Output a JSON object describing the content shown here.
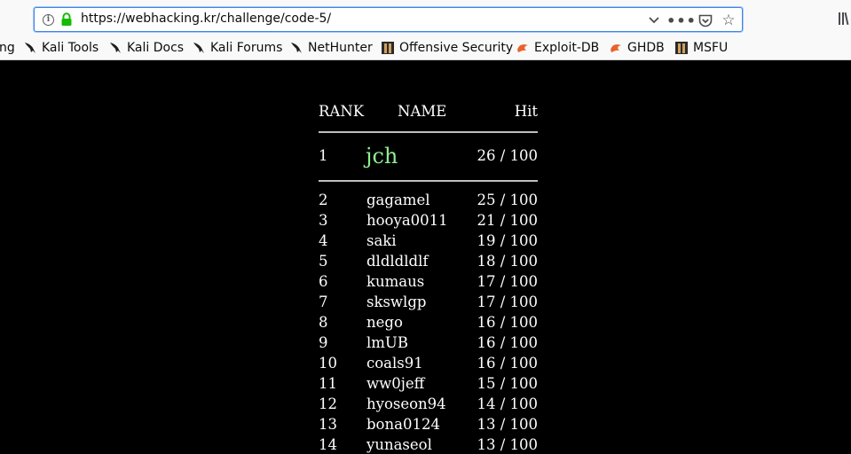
{
  "browser": {
    "url": "https://webhacking.kr/challenge/code-5/",
    "bookmarks": [
      {
        "label": "ng",
        "icon": "none"
      },
      {
        "label": "Kali Tools",
        "icon": "kali-dragon-icon"
      },
      {
        "label": "Kali Docs",
        "icon": "kali-dragon-icon"
      },
      {
        "label": "Kali Forums",
        "icon": "kali-dragon-icon"
      },
      {
        "label": "NetHunter",
        "icon": "kali-dragon-icon"
      },
      {
        "label": "Offensive Security",
        "icon": "offsec-icon"
      },
      {
        "label": "Exploit-DB",
        "icon": "exploitdb-icon"
      },
      {
        "label": "GHDB",
        "icon": "exploitdb-icon"
      },
      {
        "label": "MSFU",
        "icon": "offsec-icon"
      }
    ]
  },
  "table": {
    "headers": {
      "rank": "RANK",
      "name": "NAME",
      "hit": "Hit"
    },
    "first": {
      "rank": "1",
      "name": "jch",
      "hit": "26 / 100"
    },
    "rows": [
      {
        "rank": "2",
        "name": "gagamel",
        "hit": "25 / 100"
      },
      {
        "rank": "3",
        "name": "hooya0011",
        "hit": "21 / 100"
      },
      {
        "rank": "4",
        "name": "saki",
        "hit": "19 / 100"
      },
      {
        "rank": "5",
        "name": "dldldldlf",
        "hit": "18 / 100"
      },
      {
        "rank": "6",
        "name": "kumaus",
        "hit": "17 / 100"
      },
      {
        "rank": "7",
        "name": "skswlgp",
        "hit": "17 / 100"
      },
      {
        "rank": "8",
        "name": "nego",
        "hit": "16 / 100"
      },
      {
        "rank": "9",
        "name": "lmUB",
        "hit": "16 / 100"
      },
      {
        "rank": "10",
        "name": "coals91",
        "hit": "16 / 100"
      },
      {
        "rank": "11",
        "name": "ww0jeff",
        "hit": "15 / 100"
      },
      {
        "rank": "12",
        "name": "hyoseon94",
        "hit": "14 / 100"
      },
      {
        "rank": "13",
        "name": "bona0124",
        "hit": "13 / 100"
      },
      {
        "rank": "14",
        "name": "yunaseol",
        "hit": "13 / 100"
      }
    ]
  },
  "colors": {
    "first_place_name": "#90ee90",
    "page_background": "#000000",
    "text": "#ffffff"
  }
}
